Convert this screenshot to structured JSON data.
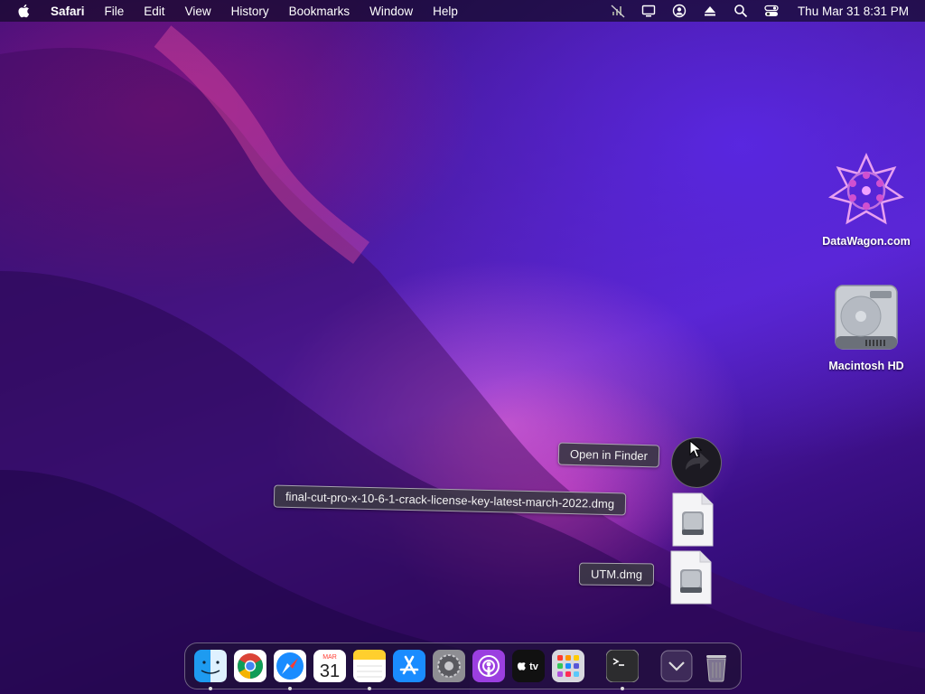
{
  "menubar": {
    "app_name": "Safari",
    "menus": [
      "File",
      "Edit",
      "View",
      "History",
      "Bookmarks",
      "Window",
      "Help"
    ],
    "status_icons": [
      "mute-icon",
      "airplay-display-icon",
      "user-account-icon",
      "eject-icon",
      "spotlight-search-icon",
      "control-center-icon"
    ],
    "clock": "Thu Mar 31  8:31 PM"
  },
  "desktop": {
    "icons": [
      {
        "label": "DataWagon.com",
        "icon": "datawagon-logo-icon"
      },
      {
        "label": "Macintosh HD",
        "icon": "hard-drive-icon"
      }
    ]
  },
  "drag": {
    "finder_label": "Open in Finder",
    "files": [
      {
        "name": "final-cut-pro-x-10-6-1-crack-license-key-latest-march-2022.dmg"
      },
      {
        "name": "UTM.dmg"
      }
    ]
  },
  "dock": {
    "apps": [
      {
        "name": "Finder",
        "icon": "finder-icon",
        "running": true
      },
      {
        "name": "Google Chrome",
        "icon": "chrome-icon",
        "running": false
      },
      {
        "name": "Safari",
        "icon": "safari-icon",
        "running": true
      },
      {
        "name": "Calendar",
        "icon": "calendar-icon",
        "running": false,
        "month": "MAR",
        "day": "31"
      },
      {
        "name": "Notes",
        "icon": "notes-icon",
        "running": true
      },
      {
        "name": "App Store",
        "icon": "app-store-icon",
        "running": false
      },
      {
        "name": "System Preferences",
        "icon": "system-preferences-icon",
        "running": false
      },
      {
        "name": "Podcasts",
        "icon": "podcasts-icon",
        "running": false
      },
      {
        "name": "Apple TV",
        "icon": "apple-tv-icon",
        "running": false,
        "text": "tv"
      },
      {
        "name": "Launchpad",
        "icon": "launchpad-icon",
        "running": false
      },
      {
        "name": "Terminal",
        "icon": "terminal-icon",
        "running": true
      },
      {
        "name": "Downloads",
        "icon": "downloads-stack-icon",
        "running": false
      },
      {
        "name": "Trash",
        "icon": "trash-icon",
        "running": false
      }
    ]
  },
  "colors": {
    "accent": "#7a3cff",
    "wallpaper_pink": "#e040c0"
  }
}
